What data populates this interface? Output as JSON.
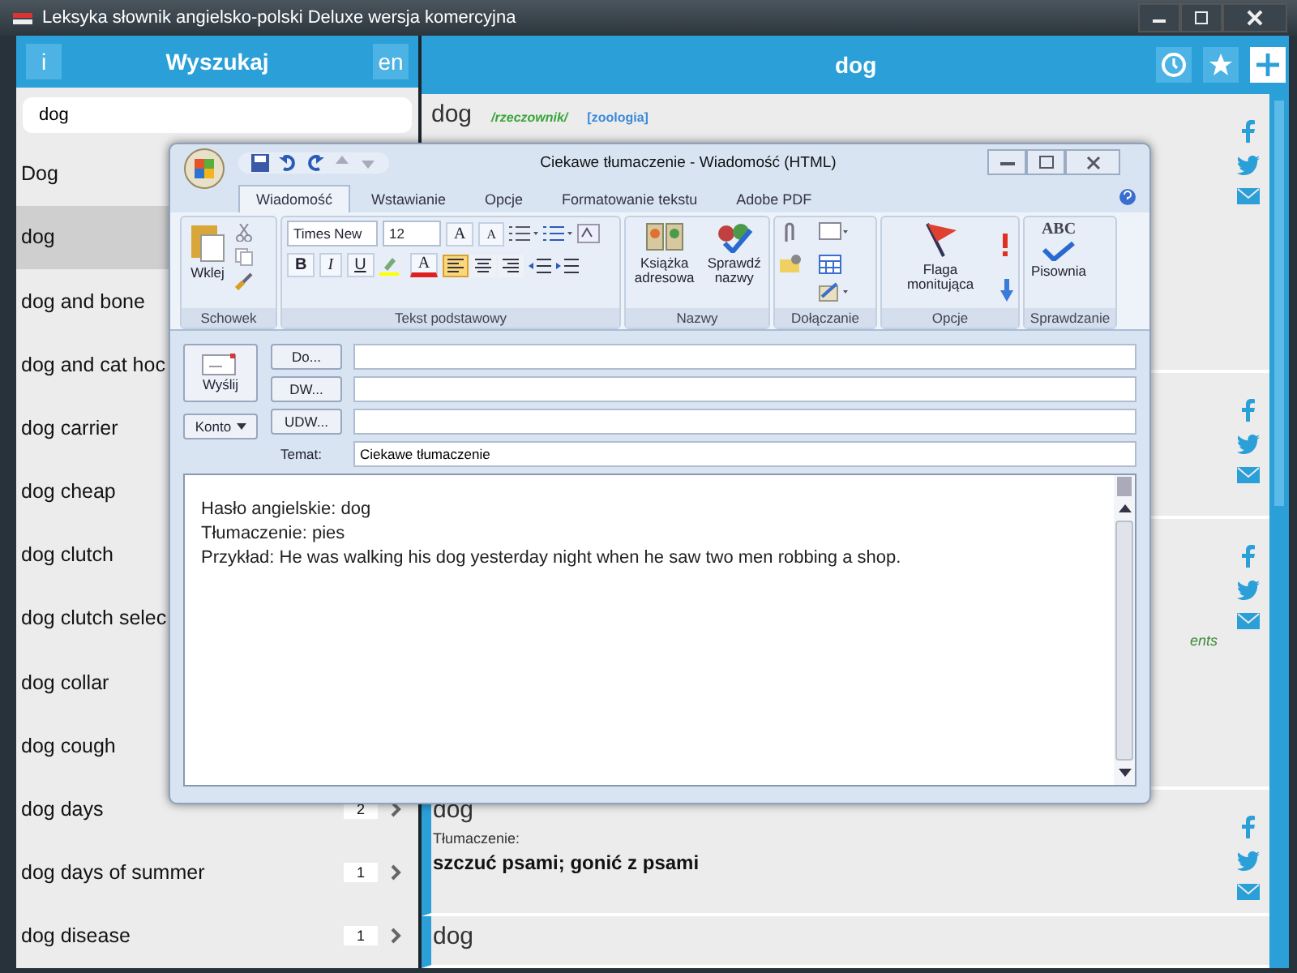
{
  "window": {
    "title": "Leksyka słownik angielsko-polski Deluxe wersja komercyjna"
  },
  "search_panel": {
    "info_button": "i",
    "title": "Wyszukaj",
    "language_button": "en",
    "search": {
      "value": "dog"
    },
    "results": [
      {
        "text": "Dog",
        "selected": false
      },
      {
        "text": "dog",
        "selected": true
      },
      {
        "text": "dog and bone",
        "selected": false
      },
      {
        "text": "dog and cat hoc",
        "selected": false
      },
      {
        "text": "dog carrier",
        "selected": false
      },
      {
        "text": "dog cheap",
        "selected": false
      },
      {
        "text": "dog clutch",
        "selected": false
      },
      {
        "text": "dog clutch selec",
        "selected": false
      },
      {
        "text": "dog collar",
        "selected": false
      },
      {
        "text": "dog cough",
        "selected": false
      },
      {
        "text": "dog days",
        "count": "2",
        "selected": false
      },
      {
        "text": "dog days of summer",
        "count": "1",
        "selected": false
      },
      {
        "text": "dog disease",
        "count": "1",
        "selected": false
      }
    ]
  },
  "entry_panel": {
    "title": "dog",
    "entries": [
      {
        "kind": "heading",
        "headword": "dog",
        "part_of_speech": "/rzeczownik/",
        "domain": "[zoologia]"
      },
      {
        "kind": "covered"
      },
      {
        "kind": "note",
        "note": "ents"
      },
      {
        "kind": "translation",
        "headword": "dog",
        "translation_label": "Tłumaczenie:",
        "translation": "szczuć psami; gonić z psami"
      },
      {
        "kind": "heading",
        "headword": "dog"
      }
    ]
  },
  "email_window": {
    "title": "Ciekawe tłumaczenie - Wiadomość (HTML)",
    "tabs": [
      {
        "label": "Wiadomość",
        "selected": true
      },
      {
        "label": "Wstawianie",
        "selected": false
      },
      {
        "label": "Opcje",
        "selected": false
      },
      {
        "label": "Formatowanie tekstu",
        "selected": false
      },
      {
        "label": "Adobe PDF",
        "selected": false
      }
    ],
    "clipboard": {
      "label": "Schowek",
      "paste": "Wklej"
    },
    "basic_text": {
      "label": "Tekst podstawowy",
      "font": "Times New",
      "size": "12",
      "grow_font": "A",
      "shrink_font": "A",
      "bold": "B",
      "italic": "I",
      "underline": "U",
      "font_color": "A",
      "alignment": [
        {
          "selected": true
        },
        {
          "selected": false
        },
        {
          "selected": false
        }
      ]
    },
    "names": {
      "label": "Nazwy",
      "address_book": "Książka adresowa",
      "check_names": "Sprawdź nazwy"
    },
    "attach": {
      "label": "Dołączanie"
    },
    "options": {
      "label": "Opcje",
      "flag": "Flaga monitująca"
    },
    "proofing": {
      "label": "Sprawdzanie",
      "spell_icon_text": "ABC",
      "spelling": "Pisownia"
    },
    "send": "Wyślij",
    "to": "Do...",
    "cc": "DW...",
    "bcc": "UDW...",
    "account": "Konto",
    "subject_label": "Temat:",
    "subject": "Ciekawe tłumaczenie",
    "body": [
      "Hasło angielskie: dog",
      "Tłumaczenie: pies",
      "Przykład: He was walking his dog yesterday night when he saw two men robbing a shop."
    ]
  }
}
